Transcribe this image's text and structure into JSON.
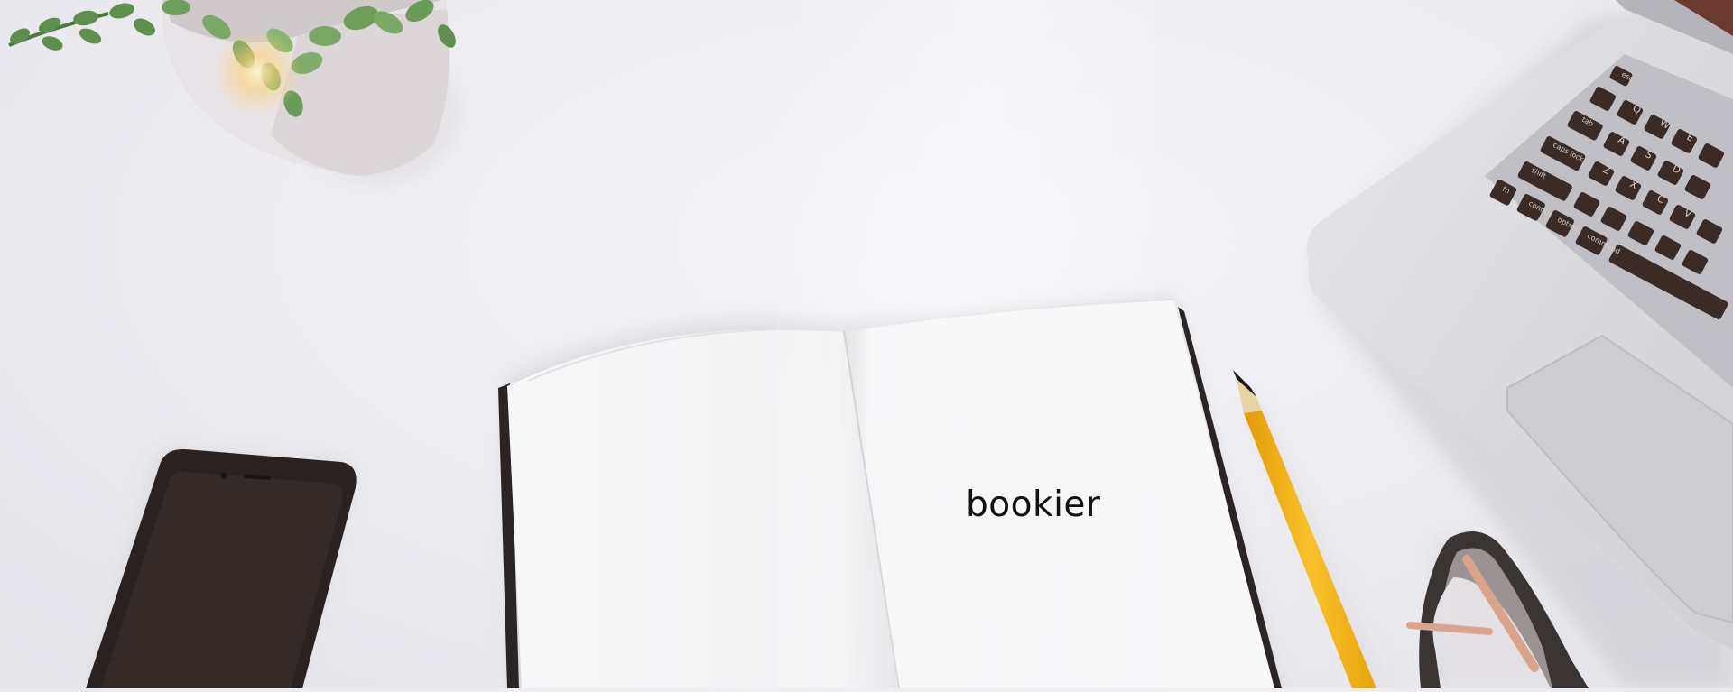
{
  "scene": {
    "caption": "bookier",
    "objects": [
      "plant-pot",
      "notebook",
      "pencil",
      "smartphone",
      "laptop",
      "eyeglasses"
    ]
  },
  "keyboard": {
    "keys": [
      [
        "esc"
      ],
      [
        "~",
        "!",
        "@",
        "#"
      ],
      [
        "tab",
        "Q",
        "W",
        "E"
      ],
      [
        "caps lock",
        "A",
        "S",
        "D"
      ],
      [
        "shift",
        "Z",
        "X",
        "C",
        "V"
      ],
      [
        "fn",
        "control",
        "option",
        "command",
        "⌘"
      ]
    ]
  },
  "colors": {
    "background": "#ececf1",
    "pencil": "#f4b21a",
    "phone": "#2a2220",
    "laptop_silver": "#d8d8dc",
    "keys": "#3a2b27",
    "leaf": "#5f8f4e"
  }
}
